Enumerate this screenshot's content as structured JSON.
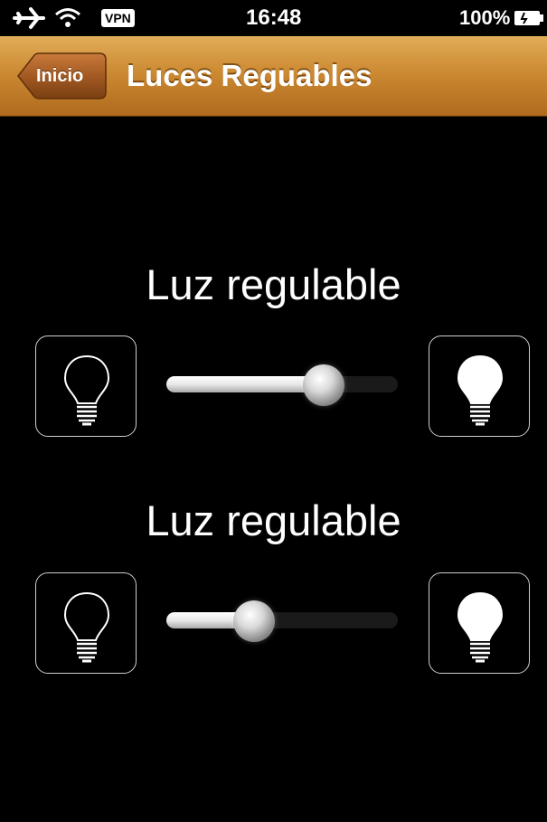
{
  "status_bar": {
    "airplane_icon": "airplane-icon",
    "wifi_icon": "wifi-icon",
    "vpn_label": "VPN",
    "time": "16:48",
    "battery_percent": "100%",
    "battery_icon": "battery-icon"
  },
  "nav": {
    "back_label": "Inicio",
    "title": "Luces Reguables",
    "accent": "#c98a34"
  },
  "controls": [
    {
      "title": "Luz regulable",
      "dim_icon": "bulb-off-icon",
      "bright_icon": "bulb-on-icon",
      "level": 0.72
    },
    {
      "title": "Luz regulable",
      "dim_icon": "bulb-off-icon",
      "bright_icon": "bulb-on-icon",
      "level": 0.35
    }
  ]
}
